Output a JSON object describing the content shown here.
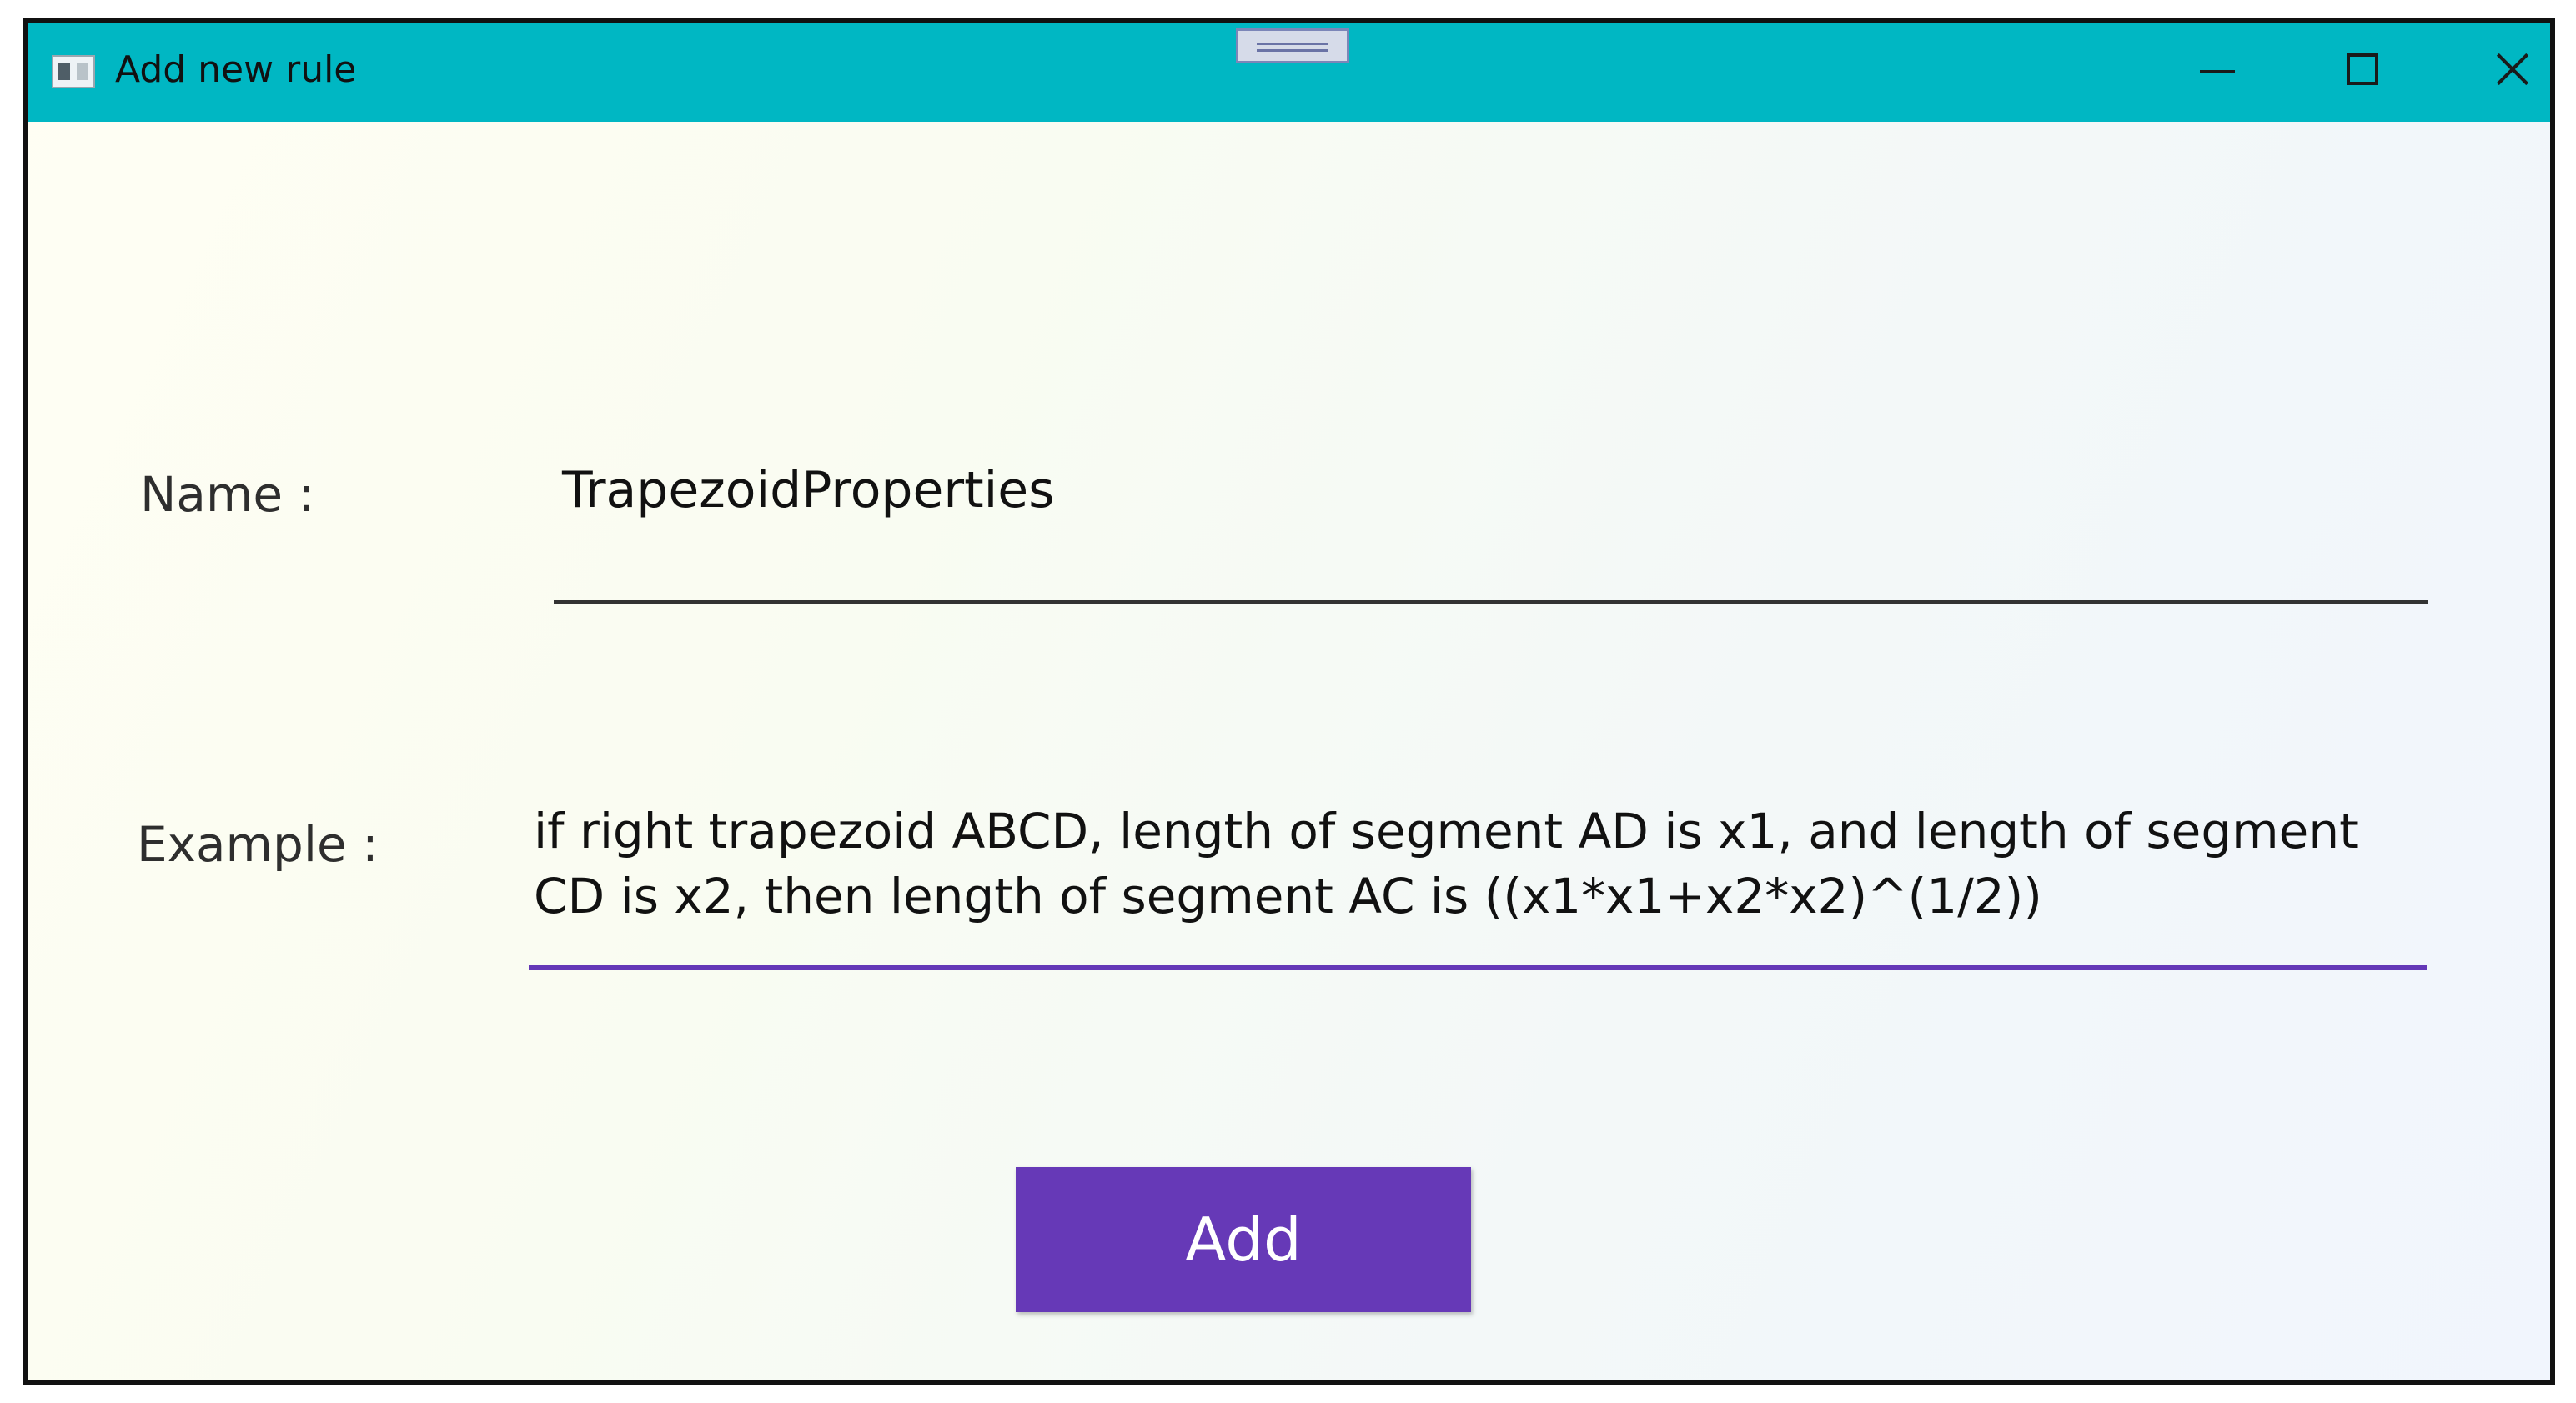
{
  "window": {
    "title": "Add new rule",
    "icon": "app-window-icon",
    "controls": {
      "minimize_icon": "minimize-icon",
      "maximize_icon": "maximize-icon",
      "close_icon": "close-icon"
    },
    "titlebar_color": "#00b7c3"
  },
  "form": {
    "name_label": "Name :",
    "name_value": "TrapezoidProperties",
    "example_label": "Example :",
    "example_value": "if right trapezoid ABCD, length of segment AD is x1, and length of segment CD is x2, then length of segment AC is ((x1*x1+x2*x2)^(1/2))",
    "focus_color": "#6438b7"
  },
  "actions": {
    "add_label": "Add",
    "add_color": "#6639b7"
  }
}
